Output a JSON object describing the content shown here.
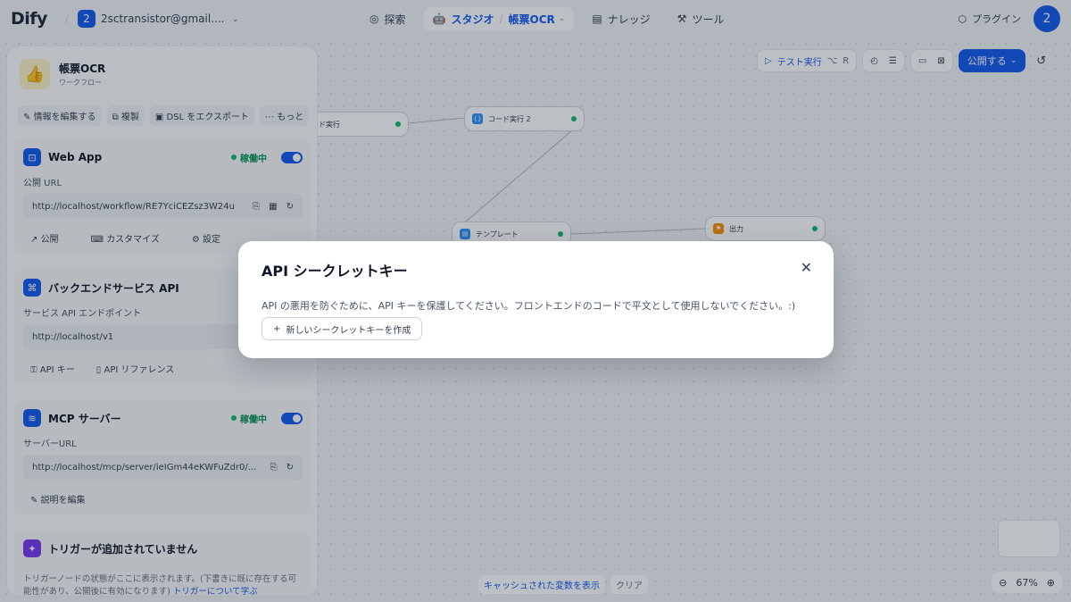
{
  "header": {
    "logo": "Dify",
    "workspace_badge": "2",
    "workspace_name": "2sctransistor@gmail....",
    "nav": {
      "explore": "探索",
      "studio": "スタジオ",
      "app_name": "帳票OCR",
      "knowledge": "ナレッジ",
      "tools": "ツール"
    },
    "plugins": "プラグイン",
    "avatar": "2"
  },
  "canvas": {
    "nodes": {
      "code1": "ード実行",
      "code2": "コード実行 2",
      "template": "テンプレート",
      "output": "出力"
    },
    "toolbar": {
      "test_run": "テスト実行",
      "shortcut_opt": "⌥",
      "shortcut_key": "R",
      "publish": "公開する"
    },
    "bottom": {
      "show_cached": "キャッシュされた変数を表示",
      "clear": "クリア"
    },
    "zoom": "67%"
  },
  "panel": {
    "app_name": "帳票OCR",
    "app_type": "ワークフロー",
    "actions": {
      "edit": "情報を編集する",
      "duplicate": "複製",
      "export": "DSL をエクスポート",
      "more": "もっと"
    },
    "webapp": {
      "title": "Web App",
      "status": "稼働中",
      "url_label": "公開 URL",
      "url": "http://localhost/workflow/RE7YciCEZsz3W24u",
      "links": [
        "公開",
        "カスタマイズ",
        "設定"
      ]
    },
    "backend": {
      "title": "バックエンドサービス API",
      "endpoint_label": "サービス API エンドポイント",
      "endpoint": "http://localhost/v1",
      "links": [
        "API キー",
        "API リファレンス"
      ]
    },
    "mcp": {
      "title": "MCP サーバー",
      "status": "稼働中",
      "url_label": "サーバーURL",
      "url": "http://localhost/mcp/server/ieIGm44eKWFuZdr0/...",
      "edit_desc": "説明を編集"
    },
    "trigger": {
      "title": "トリガーが追加されていません",
      "desc": "トリガーノードの状態がここに表示されます。(下書きに既に存在する可能性があり、公開後に有効になります)",
      "link": "トリガーについて学ぶ"
    }
  },
  "modal": {
    "title": "API シークレットキー",
    "description": "API の悪用を防ぐために、API キーを保護してください。フロントエンドのコードで平文として使用しないでください。:)",
    "create_button": "新しいシークレットキーを作成"
  }
}
